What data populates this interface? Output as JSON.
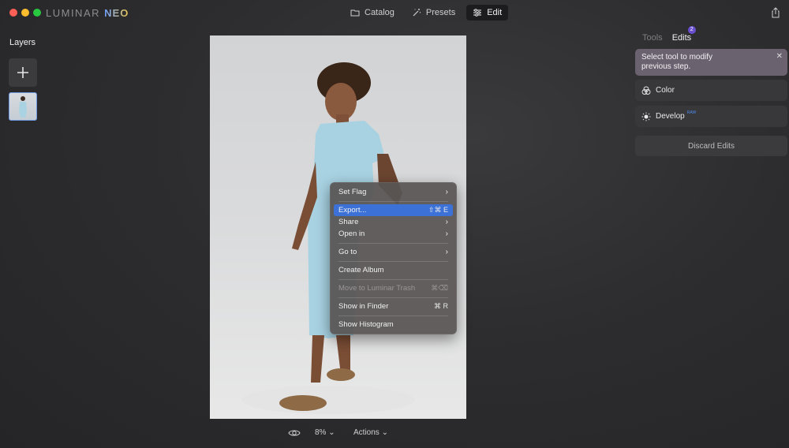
{
  "app": {
    "logo_main": "LUMINAR",
    "logo_accent": "NEO"
  },
  "nav": {
    "catalog": "Catalog",
    "presets": "Presets",
    "edit": "Edit"
  },
  "left": {
    "layers_title": "Layers"
  },
  "context_menu": {
    "set_flag": "Set Flag",
    "export": "Export...",
    "export_shortcut": "⇧⌘ E",
    "share": "Share",
    "open_in": "Open in",
    "go_to": "Go to",
    "create_album": "Create Album",
    "move_to_trash": "Move to Luminar Trash",
    "move_to_trash_shortcut": "⌘⌫",
    "show_in_finder": "Show in Finder",
    "show_in_finder_shortcut": "⌘ R",
    "show_histogram": "Show Histogram"
  },
  "bottom": {
    "zoom": "8%",
    "actions": "Actions"
  },
  "right": {
    "tab_tools": "Tools",
    "tab_edits": "Edits",
    "edits_badge": "2",
    "hint_line1": "Select tool to modify",
    "hint_line2": "previous step.",
    "color_label": "Color",
    "develop_label": "Develop",
    "develop_badge": "RAW",
    "discard_label": "Discard Edits"
  },
  "colors": {
    "accent": "#3c72d8",
    "badge": "#6a4fd0",
    "hint_bg": "#6b6270"
  }
}
